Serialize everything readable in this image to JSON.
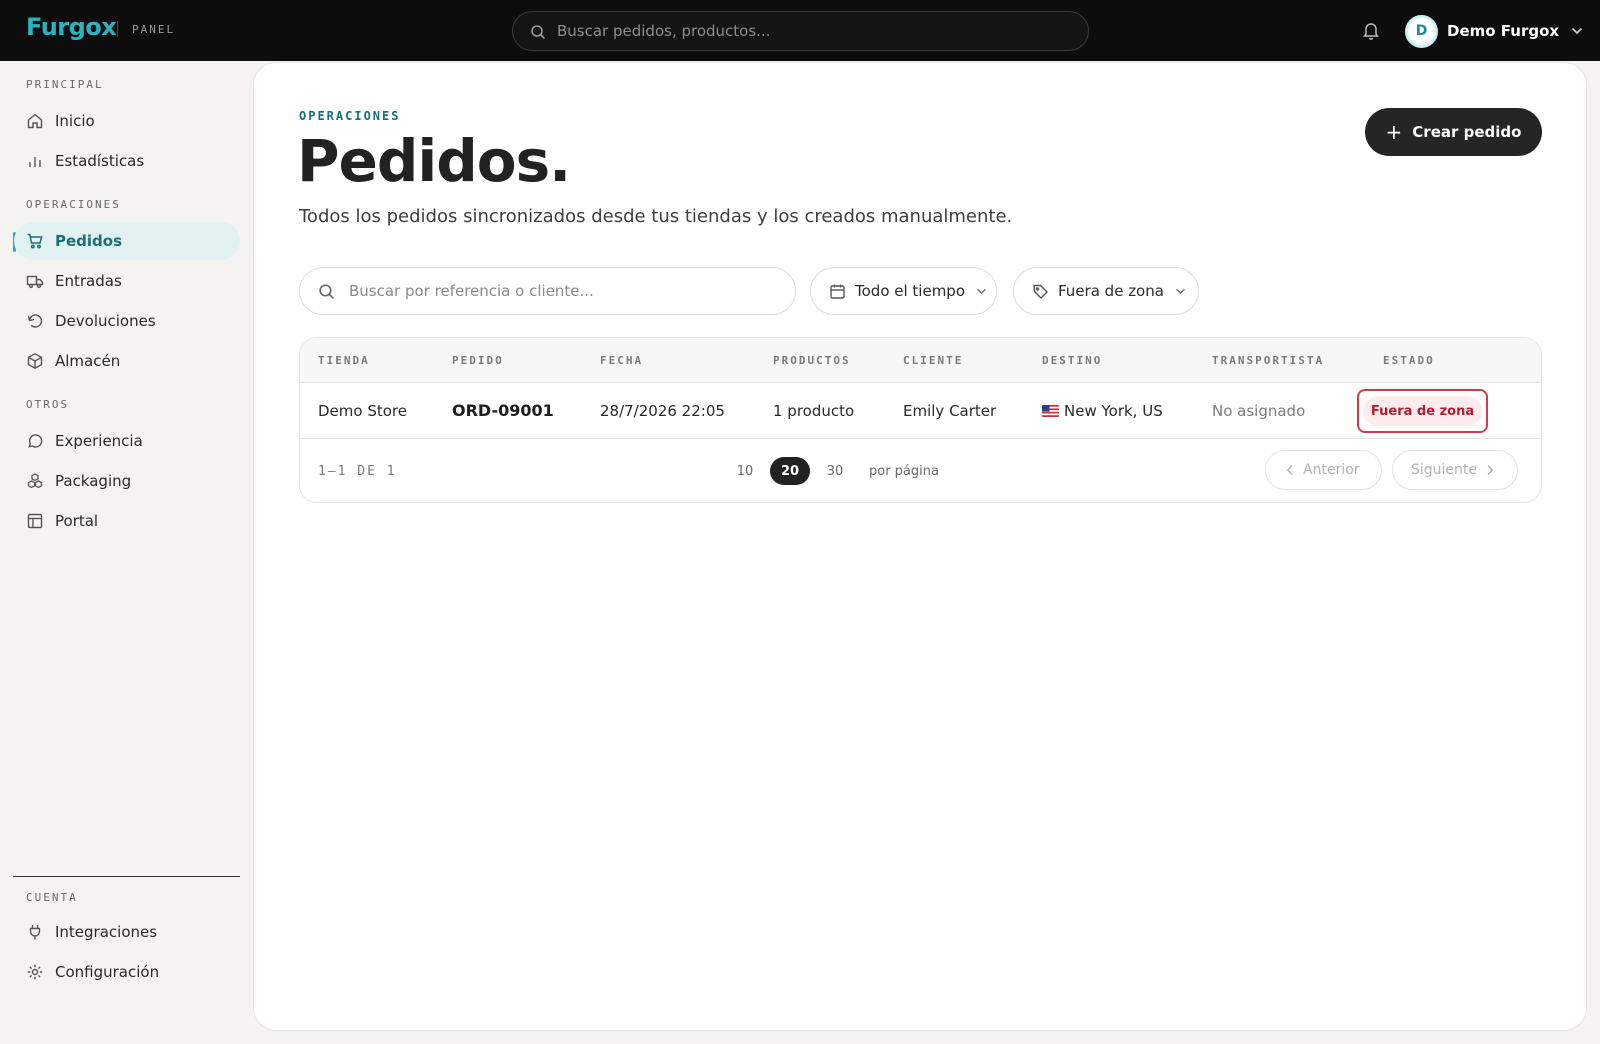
{
  "brand": {
    "logo": "Furgox",
    "section": "PANEL"
  },
  "topbar": {
    "search_placeholder": "Buscar pedidos, productos...",
    "user": {
      "initial": "D",
      "name": "Demo Furgox"
    }
  },
  "sidebar": {
    "sections": {
      "principal": "PRINCIPAL",
      "operaciones": "OPERACIONES",
      "otros": "OTROS",
      "cuenta": "CUENTA"
    },
    "items": {
      "inicio": "Inicio",
      "estadisticas": "Estadísticas",
      "pedidos": "Pedidos",
      "entradas": "Entradas",
      "devoluciones": "Devoluciones",
      "almacen": "Almacén",
      "experiencia": "Experiencia",
      "packaging": "Packaging",
      "portal": "Portal",
      "integraciones": "Integraciones",
      "configuracion": "Configuración"
    },
    "active": "pedidos"
  },
  "page": {
    "eyebrow": "OPERACIONES",
    "title": "Pedidos.",
    "subtitle": "Todos los pedidos sincronizados desde tus tiendas y los creados manualmente.",
    "create_button": "Crear pedido"
  },
  "filters": {
    "search_placeholder": "Buscar por referencia o cliente...",
    "date_range": "Todo el tiempo",
    "status": "Fuera de zona"
  },
  "table": {
    "columns": {
      "tienda": "TIENDA",
      "pedido": "PEDIDO",
      "fecha": "FECHA",
      "productos": "PRODUCTOS",
      "cliente": "CLIENTE",
      "destino": "DESTINO",
      "transportista": "TRANSPORTISTA",
      "estado": "ESTADO"
    },
    "rows": [
      {
        "tienda": "Demo Store",
        "pedido": "ORD-09001",
        "fecha": "28/7/2026 22:05",
        "productos": "1 producto",
        "cliente": "Emily Carter",
        "destino": "New York, US",
        "destino_flag": "us-flag",
        "transportista": "No asignado",
        "estado": "Fuera de zona"
      }
    ]
  },
  "pagination": {
    "range": "1–1 DE 1",
    "page_sizes": [
      "10",
      "20",
      "30"
    ],
    "selected_page_size": "20",
    "per_page_label": "por página",
    "prev": "Anterior",
    "next": "Siguiente"
  },
  "colors": {
    "brand": "#2bb3c0",
    "accent": "#17707a",
    "active_nav_bg": "#e2f2f3",
    "danger": "#b31d2c",
    "dark_button": "#252525"
  }
}
